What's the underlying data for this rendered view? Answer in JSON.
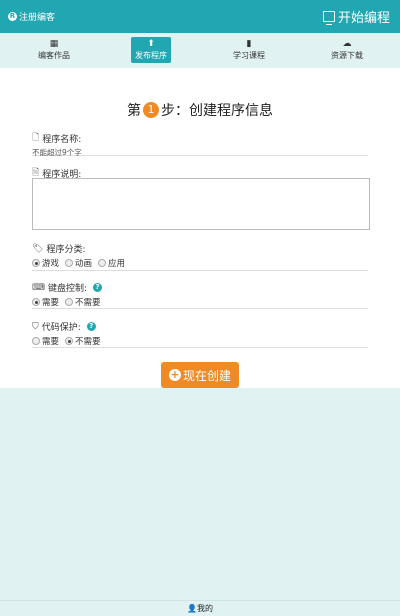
{
  "topbar": {
    "register_label": "注册编客",
    "register_icon": "registered-icon",
    "start_label": "开始编程",
    "start_icon": "monitor-icon"
  },
  "nav": {
    "items": [
      {
        "label": "编客作品",
        "icon": "grid-icon",
        "glyph": "▦"
      },
      {
        "label": "发布程序",
        "icon": "upload-icon",
        "glyph": "⬆"
      },
      {
        "label": "学习课程",
        "icon": "book-icon",
        "glyph": "▮"
      },
      {
        "label": "资源下载",
        "icon": "cloud-download-icon",
        "glyph": "☁"
      }
    ],
    "active_index": 1
  },
  "form": {
    "step_prefix": "第",
    "step_number": "1",
    "step_suffix": "步：创建程序信息",
    "name_label": "程序名称:",
    "name_hint": "不能超过9个字",
    "desc_label": "程序说明:",
    "category_label": "程序分类:",
    "category_options": [
      "游戏",
      "动画",
      "应用"
    ],
    "category_selected": "游戏",
    "keyboard_label": "键盘控制:",
    "keyboard_options": [
      "需要",
      "不需要"
    ],
    "keyboard_selected": "需要",
    "protect_label": "代码保护:",
    "protect_options": [
      "需要",
      "不需要"
    ],
    "protect_selected": "不需要",
    "help_glyph": "?",
    "create_label": "现在创建"
  },
  "bottombar": {
    "me_label": "我的",
    "me_icon": "user-icon"
  },
  "colors": {
    "accent": "#21a7b2",
    "orange": "#f08a24",
    "background": "#e1f2f3"
  }
}
